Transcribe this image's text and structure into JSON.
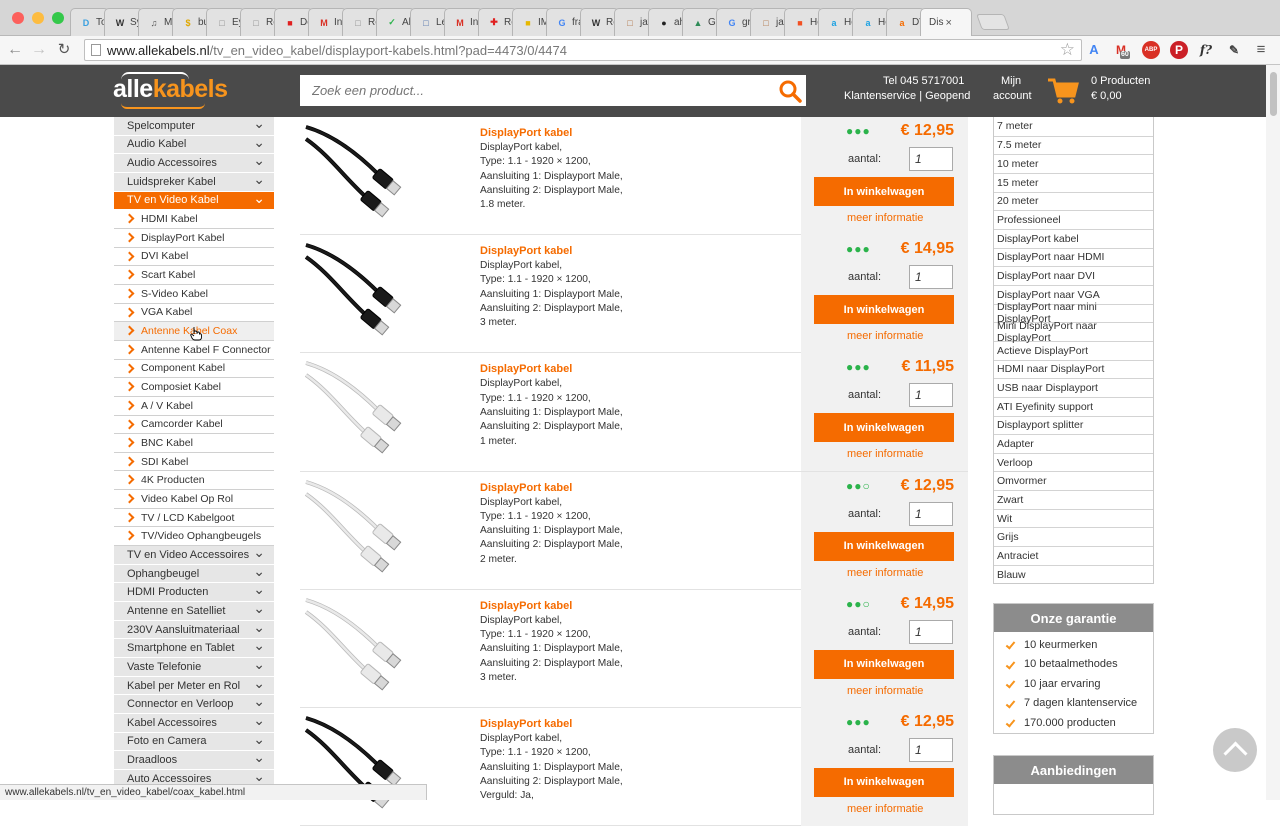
{
  "browser": {
    "tabs": [
      {
        "label": "Tod",
        "fav": "D",
        "fav_color": "#3aa0e0"
      },
      {
        "label": "Sys",
        "fav": "W",
        "fav_color": "#333333"
      },
      {
        "label": "Mu",
        "fav": "♫",
        "fav_color": "#555555"
      },
      {
        "label": "bu",
        "fav": "$",
        "fav_color": "#e0a800"
      },
      {
        "label": "Eye",
        "fav": "□",
        "fav_color": "#888888"
      },
      {
        "label": "Re",
        "fav": "□",
        "fav_color": "#888888"
      },
      {
        "label": "Des",
        "fav": "■",
        "fav_color": "#e02020"
      },
      {
        "label": "Inb",
        "fav": "M",
        "fav_color": "#d93025"
      },
      {
        "label": "Rea",
        "fav": "□",
        "fav_color": "#888888"
      },
      {
        "label": "All",
        "fav": "✓",
        "fav_color": "#2bb34b"
      },
      {
        "label": "Lev",
        "fav": "□",
        "fav_color": "#4a6ea9"
      },
      {
        "label": "Inb",
        "fav": "M",
        "fav_color": "#d93025"
      },
      {
        "label": "Re",
        "fav": "✚",
        "fav_color": "#e02020"
      },
      {
        "label": "IMI",
        "fav": "■",
        "fav_color": "#e6b800"
      },
      {
        "label": "fra",
        "fav": "G",
        "fav_color": "#4285f4"
      },
      {
        "label": "Re",
        "fav": "W",
        "fav_color": "#333333"
      },
      {
        "label": "jav",
        "fav": "□",
        "fav_color": "#b07040"
      },
      {
        "label": "ahe",
        "fav": "●",
        "fav_color": "#222222"
      },
      {
        "label": "Gra",
        "fav": "▲",
        "fav_color": "#2e8b57"
      },
      {
        "label": "gra",
        "fav": "G",
        "fav_color": "#4285f4"
      },
      {
        "label": "jav",
        "fav": "□",
        "fav_color": "#b07040"
      },
      {
        "label": "Ho",
        "fav": "■",
        "fav_color": "#f25022"
      },
      {
        "label": "Ho",
        "fav": "a",
        "fav_color": "#1ba1e2"
      },
      {
        "label": "Ho",
        "fav": "a",
        "fav_color": "#1ba1e2"
      },
      {
        "label": "DV",
        "fav": "a",
        "fav_color": "#f56b00"
      }
    ],
    "active_tab": {
      "label": "Dis",
      "close": "×"
    },
    "url_host": "www.allekabels.nl",
    "url_path": "/tv_en_video_kabel/displayport-kabels.html?pad=4473/0/4474",
    "status_url": "www.allekabels.nl/tv_en_video_kabel/coax_kabel.html",
    "ext_badge": "60",
    "ext_abp": "ABP",
    "ext_f": "f?"
  },
  "header": {
    "logo_part1": "alle",
    "logo_part2": "kabels",
    "search_placeholder": "Zoek een product...",
    "phone": "Tel 045 5717001",
    "service": "Klantenservice | Geopend",
    "account_line1": "Mijn",
    "account_line2": "account",
    "cart_count": "0 Producten",
    "cart_total": "€ 0,00"
  },
  "leftnav": {
    "top_categories": [
      "Spelcomputer",
      "Audio Kabel",
      "Audio Accessoires",
      "Luidspreker Kabel"
    ],
    "active_category": "TV en Video Kabel",
    "subcategories": [
      "HDMI Kabel",
      "DisplayPort Kabel",
      "DVI Kabel",
      "Scart Kabel",
      "S-Video Kabel",
      "VGA Kabel",
      "Antenne Kabel Coax",
      "Antenne Kabel F Connector",
      "Component Kabel",
      "Composiet Kabel",
      "A / V Kabel",
      "Camcorder Kabel",
      "BNC Kabel",
      "SDI Kabel",
      "4K Producten",
      "Video Kabel Op Rol",
      "TV / LCD Kabelgoot",
      "TV/Video Ophangbeugels"
    ],
    "hovered_subcategory": "Antenne Kabel Coax",
    "bottom_categories": [
      "TV en Video Accessoires",
      "Ophangbeugel",
      "HDMI Producten",
      "Antenne en Satelliet",
      "230V Aansluitmateriaal",
      "Smartphone en Tablet",
      "Vaste Telefonie",
      "Kabel per Meter en Rol",
      "Connector en Verloop",
      "Kabel Accessoires",
      "Foto en Camera",
      "Draadloos",
      "Auto Accessoires"
    ]
  },
  "products": {
    "qty_label": "aantal:",
    "cart_label": "In winkelwagen",
    "more_label": "meer informatie",
    "items": [
      {
        "title": "DisplayPort kabel",
        "lines": [
          "DisplayPort kabel,",
          "Type: 1.1 - 1920 × 1200,",
          "Aansluiting 1: Displayport Male,",
          "Aansluiting 2: Displayport Male,",
          "1.8 meter."
        ],
        "price": "€ 12,95",
        "stock": 3,
        "qty": "1",
        "color": "black"
      },
      {
        "title": "DisplayPort kabel",
        "lines": [
          "DisplayPort kabel,",
          "Type: 1.1 - 1920 × 1200,",
          "Aansluiting 1: Displayport Male,",
          "Aansluiting 2: Displayport Male,",
          "3 meter."
        ],
        "price": "€ 14,95",
        "stock": 3,
        "qty": "1",
        "color": "black"
      },
      {
        "title": "DisplayPort kabel",
        "lines": [
          "DisplayPort kabel,",
          "Type: 1.1 - 1920 × 1200,",
          "Aansluiting 1: Displayport Male,",
          "Aansluiting 2: Displayport Male,",
          "1 meter."
        ],
        "price": "€ 11,95",
        "stock": 3,
        "qty": "1",
        "color": "white"
      },
      {
        "title": "DisplayPort kabel",
        "lines": [
          "DisplayPort kabel,",
          "Type: 1.1 - 1920 × 1200,",
          "Aansluiting 1: Displayport Male,",
          "Aansluiting 2: Displayport Male,",
          "2 meter."
        ],
        "price": "€ 12,95",
        "stock": 2,
        "qty": "1",
        "color": "white"
      },
      {
        "title": "DisplayPort kabel",
        "lines": [
          "DisplayPort kabel,",
          "Type: 1.1 - 1920 × 1200,",
          "Aansluiting 1: Displayport Male,",
          "Aansluiting 2: Displayport Male,",
          "3 meter."
        ],
        "price": "€ 14,95",
        "stock": 2,
        "qty": "1",
        "color": "white"
      },
      {
        "title": "DisplayPort kabel",
        "lines": [
          "DisplayPort kabel,",
          "Type: 1.1 - 1920 × 1200,",
          "Aansluiting 1: Displayport Male,",
          "Aansluiting 2: Displayport Male,",
          "Verguld: Ja,"
        ],
        "price": "€ 12,95",
        "stock": 3,
        "qty": "1",
        "color": "black"
      }
    ]
  },
  "filters": {
    "items": [
      "7 meter",
      "7.5 meter",
      "10 meter",
      "15 meter",
      "20 meter",
      "Professioneel",
      "DisplayPort kabel",
      "DisplayPort naar HDMI",
      "DisplayPort naar DVI",
      "DisplayPort naar VGA",
      "DisplayPort naar mini DisplayPort",
      "Mini DisplayPort naar DisplayPort",
      "Actieve DisplayPort",
      "HDMI naar DisplayPort",
      "USB naar Displayport",
      "ATI Eyefinity support",
      "Displayport splitter",
      "Adapter",
      "Verloop",
      "Omvormer",
      "Zwart",
      "Wit",
      "Grijs",
      "Antraciet",
      "Blauw"
    ]
  },
  "guarantee": {
    "title": "Onze garantie",
    "items": [
      "10 keurmerken",
      "10 betaalmethodes",
      "10 jaar ervaring",
      "7 dagen klantenservice",
      "170.000 producten"
    ]
  },
  "offers": {
    "title": "Aanbiedingen"
  },
  "colors": {
    "accent": "#f56b00",
    "header_bg": "#4a4a4a",
    "stock_green": "#2bb34b"
  }
}
